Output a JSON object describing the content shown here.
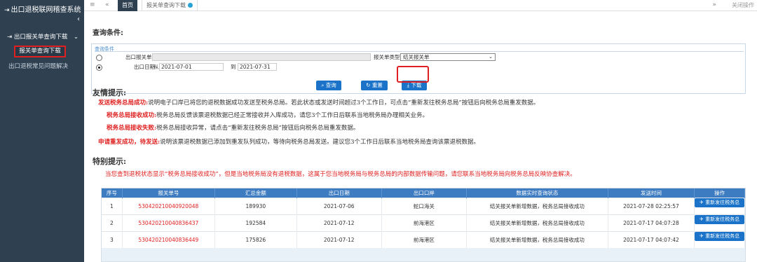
{
  "sidebar": {
    "title": "出口退税联网稽查系统",
    "group_label": "出口报关单查询下载",
    "active_item": "报关单查询下载",
    "item2": "出口退税常见问题解决"
  },
  "topbar": {
    "home_tab": "首页",
    "active_tab": "报关单查询下载",
    "close_ops": "关闭操作"
  },
  "query": {
    "heading": "查询条件:",
    "legend": "查询条件",
    "decl_no_label": "出口报关单号",
    "decl_type_label": "报关单类型",
    "decl_type_value": "结关报关单",
    "date_label": "出口日期",
    "from_label": "从",
    "from_value": "2021-07-01",
    "to_label": "到",
    "to_value": "2021-07-31",
    "search_btn": "查询",
    "reset_btn": "重置",
    "download_btn": "下载"
  },
  "tips": {
    "heading": "友情提示:",
    "items": [
      {
        "key": "发送税务总局成功:",
        "text": "说明电子口岸已将您的退税数据成功发送至税务总局。若此状态或发送时间超过3个工作日，可点击“重新发往税务总局”按钮后向税务总局重发数据。"
      },
      {
        "key": "税务总局接收成功:",
        "text": "税务总局反馈该票退税数据已经正常接收并入库成功，请您3个工作日后联系当地税务局办理相关业务。"
      },
      {
        "key": "税务总局接收失败:",
        "text": "税务总局接收异常，请点击“重新发往税务总局”按钮后向税务总局重发数据。"
      },
      {
        "key": "申请重发成功，待发送:",
        "text": "说明该票退税数据已添加到重发队列成功，等待向税务总局发送。建议您3个工作日后联系当地税务局查询该票退税数据。"
      }
    ],
    "special_heading": "特别提示:",
    "special_text": "当您查到退税状态显示“税务总局接收成功”，但是当地税务局没有退税数据，这属于您当地税务局与税务总局的内部数据传输问题，请您联系当地税务局向税务总局反映协查解决。"
  },
  "table": {
    "headers": [
      "序号",
      "报关单号",
      "汇总金额",
      "出口日期",
      "出口口岸",
      "数据实时查询状态",
      "发送时间",
      "操作"
    ],
    "rows": [
      {
        "no": "1",
        "decl": "530420210040920048",
        "amount": "189930",
        "date": "2021-07-06",
        "port": "蛇口海关",
        "status": "结关报关单新增数据，税务总局接收成功",
        "sent": "2021-07-28 02:25:57",
        "op": "重新发往税务总局"
      },
      {
        "no": "2",
        "decl": "530420210040836437",
        "amount": "192584",
        "date": "2021-07-12",
        "port": "前海港区",
        "status": "结关报关单新增数据，税务总局接收成功",
        "sent": "2021-07-17 04:07:28",
        "op": "重新发往税务总局"
      },
      {
        "no": "3",
        "decl": "530420210040836449",
        "amount": "175826",
        "date": "2021-07-12",
        "port": "前海港区",
        "status": "结关报关单新增数据，税务总局接收成功",
        "sent": "2021-07-17 04:07:42",
        "op": "重新发往税务总局"
      }
    ]
  },
  "colors": {
    "sidebar": "#2f4050",
    "accent": "#1a73c9",
    "highlight": "#e02020",
    "table_header": "#3d7cc0"
  }
}
